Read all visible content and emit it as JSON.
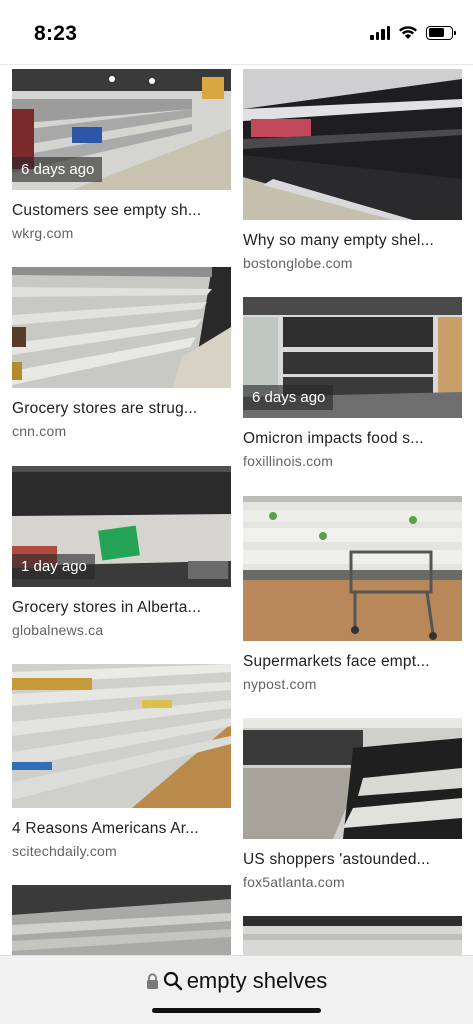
{
  "status_bar": {
    "time": "8:23",
    "battery_level": 0.7
  },
  "results_left": [
    {
      "age": "6 days ago",
      "title": "Customers see empty sh...",
      "source": "wkrg.com"
    },
    {
      "age": "",
      "title": "Grocery stores are strug...",
      "source": "cnn.com"
    },
    {
      "age": "1 day ago",
      "title": "Grocery stores in Alberta...",
      "source": "globalnews.ca"
    },
    {
      "age": "",
      "title": "4 Reasons Americans Ar...",
      "source": "scitechdaily.com"
    }
  ],
  "results_right": [
    {
      "age": "",
      "title": "Why so many empty shel...",
      "source": "bostonglobe.com"
    },
    {
      "age": "6 days ago",
      "title": "Omicron impacts food s...",
      "source": "foxillinois.com"
    },
    {
      "age": "",
      "title": "Supermarkets face empt...",
      "source": "nypost.com"
    },
    {
      "age": "",
      "title": "US shoppers 'astounded...",
      "source": "fox5atlanta.com"
    }
  ],
  "bottom_bar": {
    "query": "empty shelves"
  },
  "icons": {
    "lock": "lock-icon",
    "search": "search-icon",
    "wifi": "wifi-icon",
    "signal": "signal-icon",
    "battery": "battery-icon"
  }
}
